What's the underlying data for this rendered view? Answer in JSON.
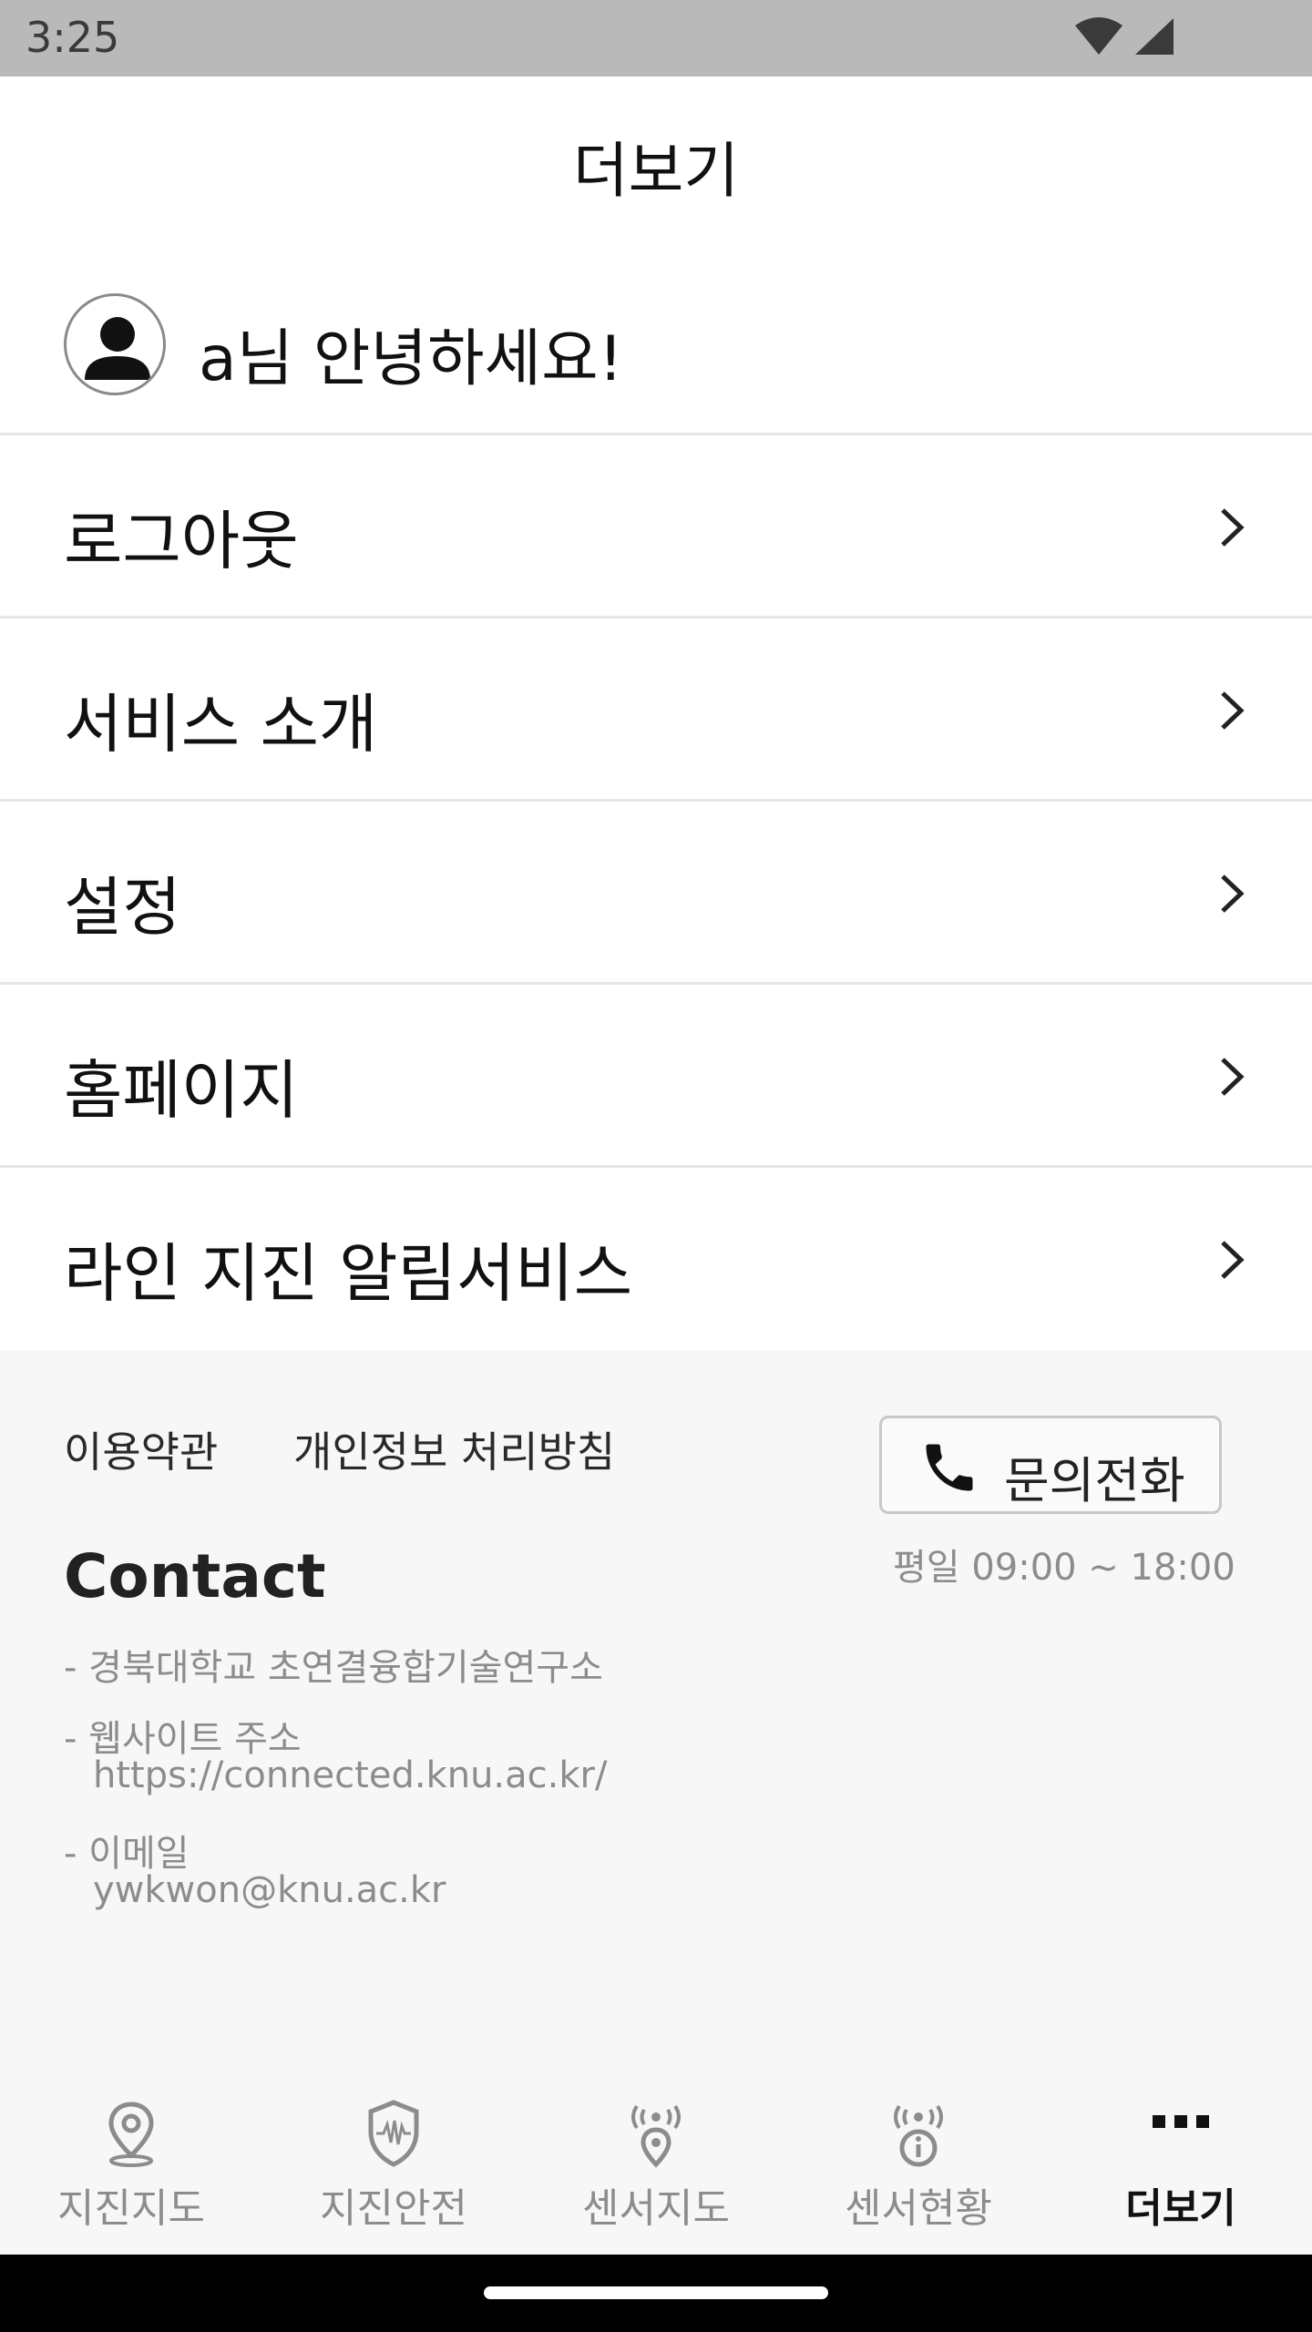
{
  "status_bar": {
    "time": "3:25"
  },
  "header": {
    "title": "더보기"
  },
  "user": {
    "greeting": "a님 안녕하세요!"
  },
  "menu": [
    {
      "label": "로그아웃"
    },
    {
      "label": "서비스 소개"
    },
    {
      "label": "설정"
    },
    {
      "label": "홈페이지"
    },
    {
      "label": "라인 지진 알림서비스"
    }
  ],
  "footer": {
    "terms": "이용약관",
    "privacy": "개인정보 처리방침",
    "call_label": "문의전화",
    "hours": "평일 09:00 ~ 18:00",
    "contact_title": "Contact",
    "org": "- 경북대학교 초연결융합기술연구소",
    "website_label": "- 웹사이트 주소",
    "website_url": "https://connected.knu.ac.kr/",
    "email_label": "- 이메일",
    "email": "ywkwon@knu.ac.kr"
  },
  "bottom_nav": {
    "items": [
      {
        "label": "지진지도",
        "icon": "map-pin-icon"
      },
      {
        "label": "지진안전",
        "icon": "shield-wave-icon"
      },
      {
        "label": "센서지도",
        "icon": "sensor-pin-icon"
      },
      {
        "label": "센서현황",
        "icon": "sensor-info-icon"
      },
      {
        "label": "더보기",
        "icon": "more-dots-icon"
      }
    ],
    "active_index": 4
  },
  "colors": {
    "accent": "#111111",
    "inactive": "#8c8c8c",
    "footer_bg": "#f7f7f7"
  }
}
